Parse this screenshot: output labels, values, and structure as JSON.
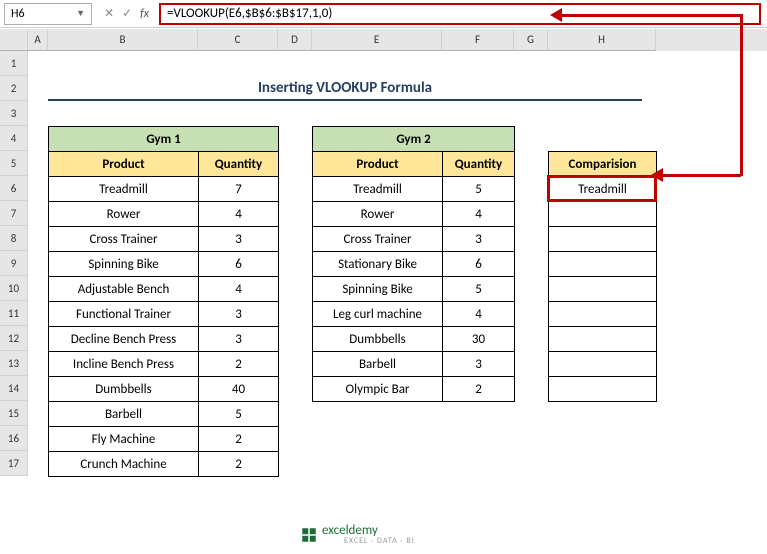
{
  "nameBox": "H6",
  "formula": "=VLOOKUP(E6,$B$6:$B$17,1,0)",
  "title": "Inserting VLOOKUP Formula",
  "cols": [
    "A",
    "B",
    "C",
    "D",
    "E",
    "F",
    "G",
    "H"
  ],
  "rows": [
    "1",
    "2",
    "3",
    "4",
    "5",
    "6",
    "7",
    "8",
    "9",
    "10",
    "11",
    "12",
    "13",
    "14",
    "15",
    "16",
    "17"
  ],
  "gym1": {
    "title": "Gym 1",
    "headers": [
      "Product",
      "Quantity"
    ],
    "data": [
      [
        "Treadmill",
        "7"
      ],
      [
        "Rower",
        "4"
      ],
      [
        "Cross Trainer",
        "3"
      ],
      [
        "Spinning Bike",
        "6"
      ],
      [
        "Adjustable Bench",
        "4"
      ],
      [
        "Functional Trainer",
        "3"
      ],
      [
        "Decline Bench Press",
        "3"
      ],
      [
        "Incline Bench Press",
        "2"
      ],
      [
        "Dumbbells",
        "40"
      ],
      [
        "Barbell",
        "5"
      ],
      [
        "Fly Machine",
        "2"
      ],
      [
        "Crunch Machine",
        "2"
      ]
    ]
  },
  "gym2": {
    "title": "Gym 2",
    "headers": [
      "Product",
      "Quantity"
    ],
    "data": [
      [
        "Treadmill",
        "5"
      ],
      [
        "Rower",
        "4"
      ],
      [
        "Cross Trainer",
        "3"
      ],
      [
        "Stationary Bike",
        "6"
      ],
      [
        "Spinning Bike",
        "5"
      ],
      [
        "Leg curl machine",
        "4"
      ],
      [
        "Dumbbells",
        "30"
      ],
      [
        "Barbell",
        "3"
      ],
      [
        "Olympic Bar",
        "2"
      ]
    ]
  },
  "comparison": {
    "header": "Comparision",
    "data": [
      "Treadmill",
      "",
      "",
      "",
      "",
      "",
      "",
      "",
      ""
    ]
  },
  "logo": {
    "text": "exceldemy",
    "sub": "EXCEL · DATA · BI"
  }
}
